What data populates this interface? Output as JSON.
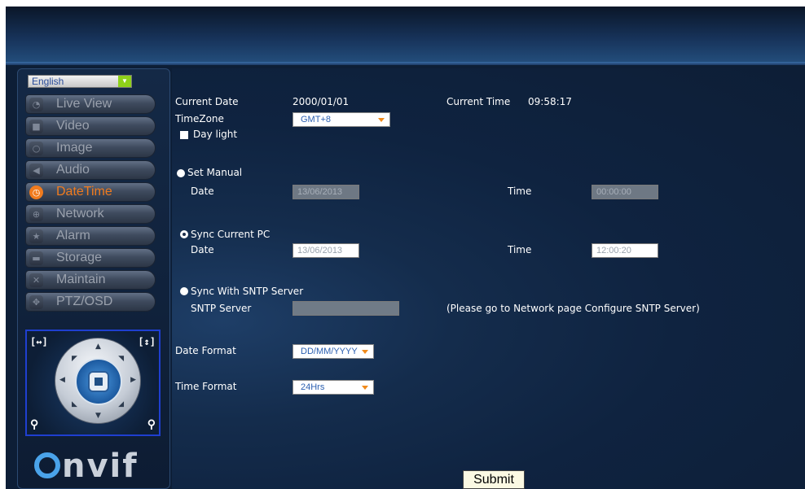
{
  "language": {
    "selected": "English"
  },
  "menu": [
    {
      "label": "Live View",
      "icon": "chat-icon",
      "active": false
    },
    {
      "label": "Video",
      "icon": "camera-icon",
      "active": false
    },
    {
      "label": "Image",
      "icon": "power-icon",
      "active": false
    },
    {
      "label": "Audio",
      "icon": "speaker-icon",
      "active": false
    },
    {
      "label": "DateTime",
      "icon": "clock-icon",
      "active": true
    },
    {
      "label": "Network",
      "icon": "globe-icon",
      "active": false
    },
    {
      "label": "Alarm",
      "icon": "star-icon",
      "active": false
    },
    {
      "label": "Storage",
      "icon": "drive-icon",
      "active": false
    },
    {
      "label": "Maintain",
      "icon": "tools-icon",
      "active": false
    },
    {
      "label": "PTZ/OSD",
      "icon": "ptz-icon",
      "active": false
    }
  ],
  "ptz": {
    "left_corner": "[↔]",
    "right_corner": "[↕]"
  },
  "brand": {
    "logo_text": "nvif"
  },
  "datetime": {
    "current_date_label": "Current Date",
    "current_date_value": "2000/01/01",
    "current_time_label": "Current Time",
    "current_time_value": "09:58:17",
    "timezone_label": "TimeZone",
    "timezone_value": "GMT+8",
    "daylight_label": "Day light",
    "set_manual_label": "Set Manual",
    "manual_date_label": "Date",
    "manual_date_value": "13/06/2013",
    "manual_time_label": "Time",
    "manual_time_value": "00:00:00",
    "sync_pc_label": "Sync Current PC",
    "pc_date_label": "Date",
    "pc_date_value": "13/06/2013",
    "pc_time_label": "Time",
    "pc_time_value": "12:00:20",
    "sntp_label": "Sync With SNTP Server",
    "sntp_server_label": "SNTP Server",
    "sntp_server_value": "",
    "sntp_note": "(Please go to Network page Configure SNTP Server)",
    "date_format_label": "Date Format",
    "date_format_value": "DD/MM/YYYY",
    "time_format_label": "Time Format",
    "time_format_value": "24Hrs",
    "submit_label": "Submit"
  },
  "colors": {
    "accent": "#f07b1e",
    "background": "#0d1e36",
    "select_arrow": "#f08a1a"
  }
}
